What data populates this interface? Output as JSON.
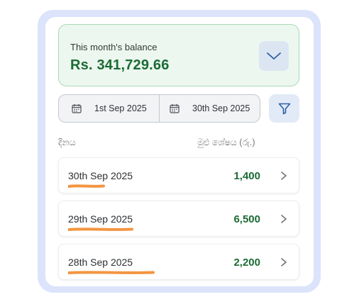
{
  "balance": {
    "label": "This month's balance",
    "amount": "Rs. 341,729.66",
    "expand_icon": "chevron-down-icon"
  },
  "date_range": {
    "start": "1st Sep 2025",
    "end": "30th Sep 2025",
    "icon": "calendar-icon"
  },
  "filter": {
    "icon": "filter-icon"
  },
  "columns": {
    "date": "දිනය",
    "balance": "මුළු ශේෂය (රු.)"
  },
  "rows": [
    {
      "date": "30th Sep 2025",
      "amount": "1,400"
    },
    {
      "date": "29th Sep 2025",
      "amount": "6,500"
    },
    {
      "date": "28th Sep 2025",
      "amount": "2,200"
    }
  ],
  "colors": {
    "accent_green": "#1b6b34",
    "card_green": "#ecf7ef",
    "frame_blue": "#dbe4fb",
    "underline_orange": "#f28a2e"
  }
}
